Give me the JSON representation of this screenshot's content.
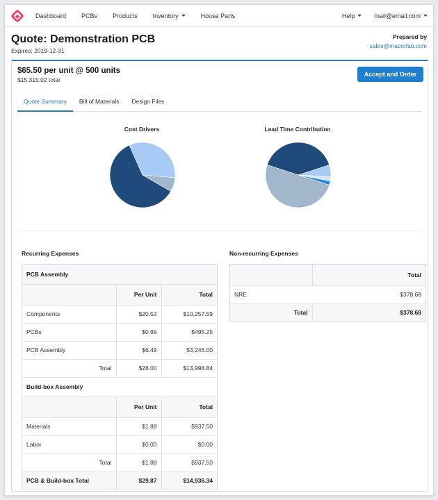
{
  "nav": {
    "items": [
      {
        "label": "Dashboard",
        "dropdown": false
      },
      {
        "label": "PCBs",
        "dropdown": false
      },
      {
        "label": "Products",
        "dropdown": false
      },
      {
        "label": "Inventory",
        "dropdown": true
      },
      {
        "label": "House Parts",
        "dropdown": false
      }
    ],
    "help_label": "Help",
    "user_email": "mail@email.com",
    "logo_icon": "macrofab-logo-icon"
  },
  "header": {
    "title": "Quote: Demonstration PCB",
    "expires_label": "Expires:",
    "expires_date": "2019-12-31",
    "prepared_by_label": "Prepared by",
    "prepared_by_email": "sales@macrofab.com"
  },
  "quote": {
    "price_line": "$65.50 per unit @ 500 units",
    "total_line": "$15,315.02 total",
    "accept_label": "Accept and Order"
  },
  "tabs": [
    {
      "label": "Quote Summary",
      "active": true
    },
    {
      "label": "Bill of Materials",
      "active": false
    },
    {
      "label": "Design Files",
      "active": false
    }
  ],
  "chart_data": [
    {
      "type": "pie",
      "title": "Cost Drivers",
      "slices": [
        {
          "value": 0.33,
          "color": "#a7cbf5"
        },
        {
          "value": 0.07,
          "color": "#a2b6cc"
        },
        {
          "value": 0.6,
          "color": "#1f4a7a"
        }
      ]
    },
    {
      "type": "pie",
      "title": "Lead Time Contribution",
      "slices": [
        {
          "value": 0.4,
          "color": "#1f4a7a"
        },
        {
          "value": 0.06,
          "color": "#a7cbf5"
        },
        {
          "value": 0.02,
          "color": "#d4e6fb"
        },
        {
          "value": 0.02,
          "color": "#2a8ad6"
        },
        {
          "value": 0.5,
          "color": "#a2b6cc"
        }
      ]
    }
  ],
  "recurring": {
    "title": "Recurring Expenses",
    "pcb_assembly": {
      "group_label": "PCB Assembly",
      "col_per_unit": "Per Unit",
      "col_total": "Total",
      "rows": [
        {
          "label": "Components",
          "per_unit": "$20.52",
          "total": "$10,257.59"
        },
        {
          "label": "PCBs",
          "per_unit": "$0.99",
          "total": "$495.25"
        },
        {
          "label": "PCB Assembly",
          "per_unit": "$6.49",
          "total": "$3,246.00"
        }
      ],
      "subtotal_label": "Total",
      "subtotal_per_unit": "$28.00",
      "subtotal_total": "$13,998.84"
    },
    "build_box": {
      "group_label": "Build-box Assembly",
      "col_per_unit": "Per Unit",
      "col_total": "Total",
      "rows": [
        {
          "label": "Materials",
          "per_unit": "$1.88",
          "total": "$937.50"
        },
        {
          "label": "Labor",
          "per_unit": "$0.00",
          "total": "$0.00"
        }
      ],
      "subtotal_label": "Total",
      "subtotal_per_unit": "$1.88",
      "subtotal_total": "$937.50"
    },
    "grand_label": "PCB & Build-box Total",
    "grand_per_unit": "$29.87",
    "grand_total": "$14,936.34"
  },
  "nonrecurring": {
    "title": "Non-recurring Expenses",
    "col_total": "Total",
    "rows": [
      {
        "label": "NRE",
        "total": "$378.68"
      }
    ],
    "total_label": "Total",
    "total_value": "$378.68"
  }
}
